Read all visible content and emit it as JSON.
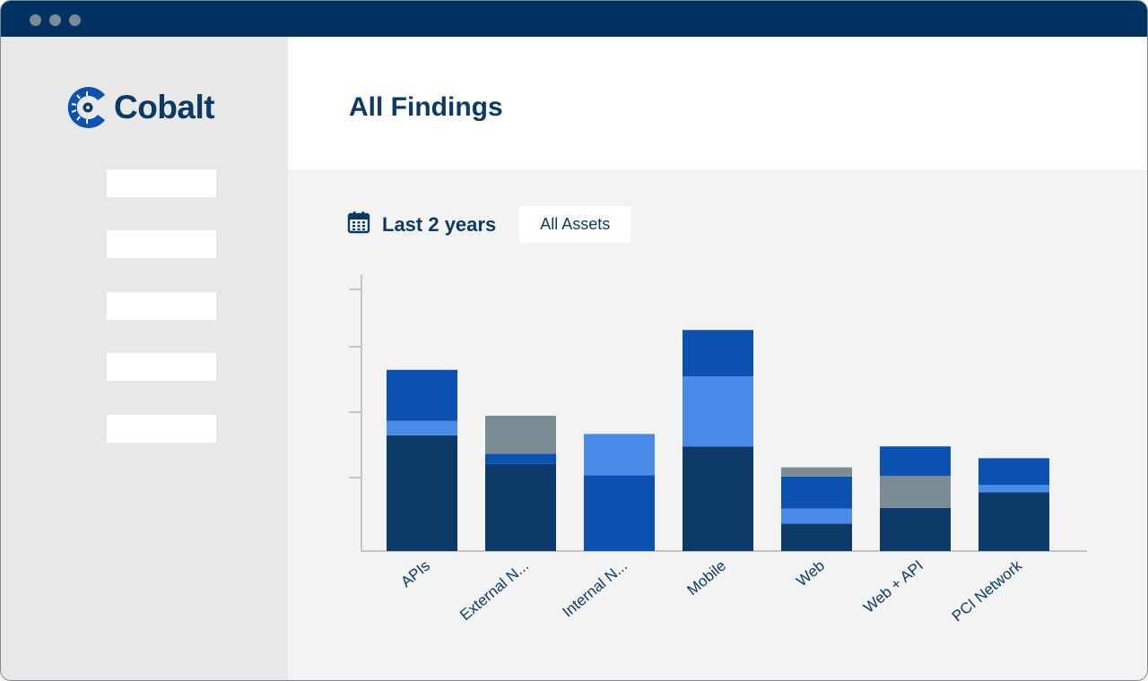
{
  "window": {
    "titlebar_color": "#023262",
    "controls": [
      "dot",
      "dot",
      "dot"
    ]
  },
  "sidebar": {
    "brand": "Cobalt",
    "logo_icon": "cobalt-gear-c-icon",
    "nav_items": [
      {
        "label": ""
      },
      {
        "label": ""
      },
      {
        "label": ""
      },
      {
        "label": ""
      },
      {
        "label": ""
      }
    ]
  },
  "header": {
    "title": "All Findings"
  },
  "filters": {
    "date_icon": "calendar-icon",
    "date_range": "Last 2 years",
    "asset_filter": "All Assets"
  },
  "colors": {
    "navy": "#0d3b69",
    "blue": "#0b51b1",
    "light_blue": "#4a8ae9",
    "gray": "#7b8c94",
    "axis": "#c4c4c4",
    "text": "#0b3a66"
  },
  "chart_data": {
    "type": "bar",
    "stacked": true,
    "title": "",
    "xlabel": "",
    "ylabel": "",
    "y_tick_labels": [],
    "ylim": [
      0,
      4.2
    ],
    "y_ticks": [
      1,
      2,
      3,
      4
    ],
    "grid": false,
    "legend": "none",
    "categories": [
      "APIs",
      "External N...",
      "Internal N...",
      "Mobile",
      "Web",
      "Web + API",
      "PCI Network"
    ],
    "series": [
      {
        "name": "navy",
        "color": "#0d3b69",
        "values": [
          1.77,
          1.33,
          0,
          1.6,
          0.42,
          0.66,
          0.9
        ]
      },
      {
        "name": "blue-lower",
        "color": "#0b51b1",
        "values": [
          0,
          0.16,
          1.16,
          0,
          0,
          0,
          0
        ]
      },
      {
        "name": "light-blue",
        "color": "#4a8ae9",
        "values": [
          0.22,
          0,
          0.63,
          1.07,
          0.23,
          0,
          0.11
        ]
      },
      {
        "name": "blue",
        "color": "#0b51b1",
        "values": [
          0.78,
          0,
          0,
          0.71,
          0.49,
          0,
          0.41
        ]
      },
      {
        "name": "gray",
        "color": "#7b8c94",
        "values": [
          0,
          0.58,
          0,
          0,
          0.14,
          0.49,
          0
        ]
      },
      {
        "name": "blue-top",
        "color": "#0b51b1",
        "values": [
          0,
          0,
          0,
          0,
          0,
          0.45,
          0
        ]
      }
    ]
  }
}
